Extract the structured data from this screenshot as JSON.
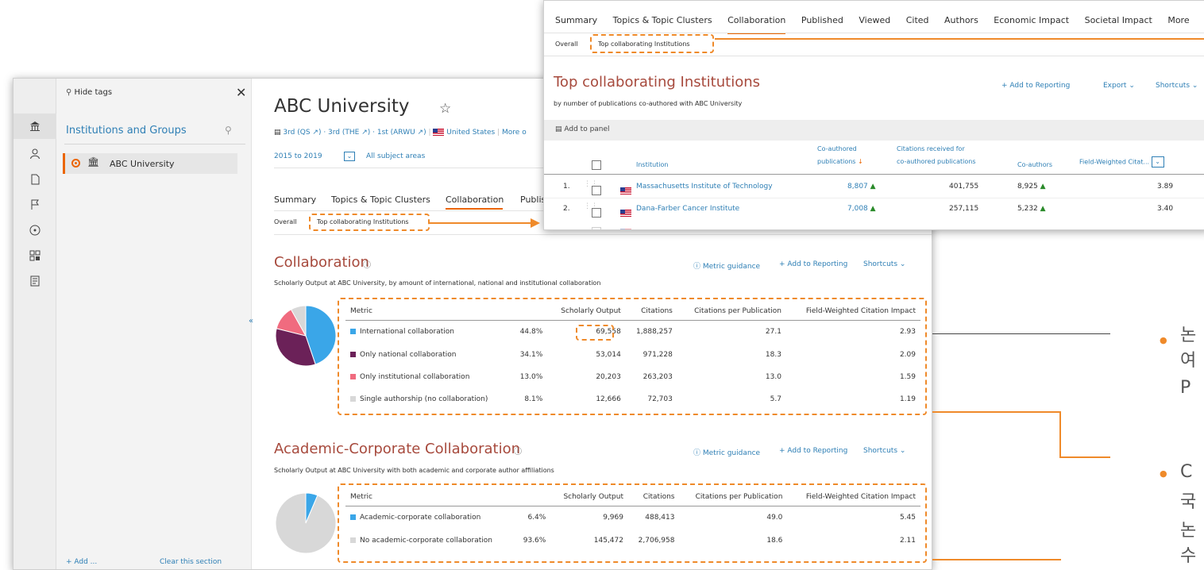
{
  "sidebar": {
    "hide_tags": "Hide tags",
    "section_title": "Institutions and Groups",
    "selected_item": "ABC University",
    "footer_add": "+ Add ...",
    "footer_clear": "Clear this section"
  },
  "header": {
    "title": "ABC University",
    "rank_text": "3rd (QS ↗) · 3rd (THE ↗) · 1st (ARWU ↗)",
    "country": "United States",
    "more": "More o",
    "years": "2015 to 2019",
    "subject": "All subject areas"
  },
  "tabs": [
    "Summary",
    "Topics & Topic Clusters",
    "Collaboration",
    "Publis"
  ],
  "subtabs": {
    "overall": "Overall",
    "top": "Top collaborating Institutions"
  },
  "collaboration": {
    "title": "Collaboration",
    "subtitle": "Scholarly Output at   ABC   University, by amount of international, national and institutional collaboration",
    "metric_guidance": "Metric guidance",
    "add_to_reporting": "+ Add to Reporting",
    "shortcuts": "Shortcuts",
    "headers": [
      "Metric",
      "Scholarly Output",
      "Citations",
      "Citations per Publication",
      "Field-Weighted Citation Impact"
    ],
    "rows": [
      {
        "name": "International collaboration",
        "color": "#3aa6e8",
        "pct": "44.8%",
        "output": "69,558",
        "citations": "1,888,257",
        "cpp": "27.1",
        "fwci": "2.93"
      },
      {
        "name": "Only national collaboration",
        "color": "#6b2158",
        "pct": "34.1%",
        "output": "53,014",
        "citations": "971,228",
        "cpp": "18.3",
        "fwci": "2.09"
      },
      {
        "name": "Only institutional collaboration",
        "color": "#f06b7f",
        "pct": "13.0%",
        "output": "20,203",
        "citations": "263,203",
        "cpp": "13.0",
        "fwci": "1.59"
      },
      {
        "name": "Single authorship (no collaboration)",
        "color": "#d8d8d8",
        "pct": "8.1%",
        "output": "12,666",
        "citations": "72,703",
        "cpp": "5.7",
        "fwci": "1.19"
      }
    ]
  },
  "academic": {
    "title": "Academic-Corporate Collaboration",
    "subtitle": "Scholarly Output at   ABC   University with both academic and corporate author affiliations",
    "metric_guidance": "Metric guidance",
    "add_to_reporting": "+ Add to Reporting",
    "shortcuts": "Shortcuts",
    "headers": [
      "Metric",
      "Scholarly Output",
      "Citations",
      "Citations per Publication",
      "Field-Weighted Citation Impact"
    ],
    "rows": [
      {
        "name": "Academic-corporate collaboration",
        "color": "#3aa6e8",
        "pct": "6.4%",
        "output": "9,969",
        "citations": "488,413",
        "cpp": "49.0",
        "fwci": "5.45"
      },
      {
        "name": "No academic-corporate collaboration",
        "color": "#d8d8d8",
        "pct": "93.6%",
        "output": "145,472",
        "citations": "2,706,958",
        "cpp": "18.6",
        "fwci": "2.11"
      }
    ]
  },
  "overlay": {
    "tabs": [
      "Summary",
      "Topics & Topic Clusters",
      "Collaboration",
      "Published",
      "Viewed",
      "Cited",
      "Authors",
      "Economic Impact",
      "Societal Impact",
      "More"
    ],
    "subtabs": {
      "overall": "Overall",
      "top": "Top collaborating Institutions"
    },
    "title": "Top collaborating Institutions",
    "subtitle": "by number of publications co-authored with   ABC   University",
    "add_to_reporting": "+ Add to Reporting",
    "export": "Export",
    "shortcuts": "Shortcuts",
    "add_to_panel": "Add to panel",
    "col_institution": "Institution",
    "col_coauthored_1": "Co-authored",
    "col_coauthored_2": "publications",
    "col_citations_1": "Citations received for",
    "col_citations_2": "co-authored publications",
    "col_coauthors": "Co-authors",
    "col_fwci": "Field-Weighted Citat...",
    "rows": [
      {
        "rank": "1.",
        "name": "Massachusetts Institute of Technology",
        "pubs": "8,807",
        "citations": "401,755",
        "coauthors": "8,925",
        "fwci": "3.89"
      },
      {
        "rank": "2.",
        "name": "Dana-Farber Cancer Institute",
        "pubs": "7,008",
        "citations": "257,115",
        "coauthors": "5,232",
        "fwci": "3.40"
      }
    ]
  },
  "bullets": [
    "논",
    "여",
    "P",
    "C",
    "국",
    "논",
    "수"
  ],
  "pie1": {
    "slices": [
      44.8,
      34.1,
      13.0,
      8.1
    ],
    "colors": [
      "#3aa6e8",
      "#6b2158",
      "#f06b7f",
      "#d8d8d8"
    ]
  },
  "pie2": {
    "slices": [
      6.4,
      93.6
    ],
    "colors": [
      "#3aa6e8",
      "#d8d8d8"
    ]
  }
}
